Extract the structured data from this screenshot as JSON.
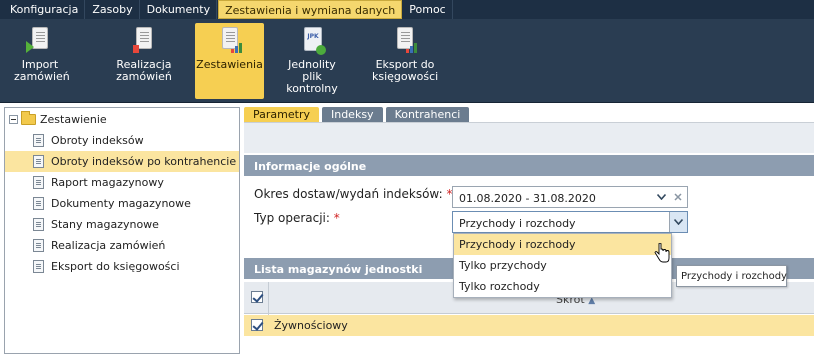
{
  "menu": {
    "items": [
      "Konfiguracja",
      "Zasoby",
      "Dokumenty",
      "Zestawienia i wymiana danych",
      "Pomoc"
    ],
    "active_index": 3
  },
  "toolbar": {
    "buttons": [
      {
        "line1": "Import",
        "line2": "zamówień",
        "icon": "import-orders-icon"
      },
      {
        "line1": "Realizacja",
        "line2": "zamówień",
        "icon": "orders-fulfillment-icon"
      },
      {
        "line1": "Zestawienia",
        "line2": "",
        "icon": "reports-icon"
      },
      {
        "line1": "Jednolity plik",
        "line2": "kontrolny",
        "icon": "jpk-file-icon"
      },
      {
        "line1": "Eksport do",
        "line2": "księgowości",
        "icon": "accounting-export-icon"
      }
    ],
    "jpk_badge": "JPK"
  },
  "tree": {
    "root": "Zestawienie",
    "items": [
      "Obroty indeksów",
      "Obroty indeksów po kontrahencie",
      "Raport magazynowy",
      "Dokumenty magazynowe",
      "Stany magazynowe",
      "Realizacja zamówień",
      "Eksport do księgowości"
    ],
    "selected_index": 1
  },
  "tabs": [
    "Parametry",
    "Indeksy",
    "Kontrahenci"
  ],
  "general": {
    "title": "Informacje ogólne",
    "period_label": "Okres dostaw/wydań indeksów:",
    "period_value": "01.08.2020 - 31.08.2020",
    "type_label": "Typ operacji:",
    "type_value": "Przychody i rozchody",
    "required_mark": "*"
  },
  "dropdown": {
    "options": [
      "Przychody i rozchody",
      "Tylko przychody",
      "Tylko rozchody"
    ],
    "highlighted_index": 0,
    "tooltip": "Przychody i rozchody"
  },
  "warehouses": {
    "title": "Lista magazynów jednostki",
    "column_header": "Skrót",
    "rows": [
      {
        "name": "Żywnościowy",
        "checked": true
      }
    ]
  },
  "colors": {
    "menu_bg": "#1d2f44",
    "toolbar_bg": "#2a3d52",
    "accent": "#f6cf52",
    "highlight": "#fbe5a0",
    "section_header": "#8d9db0",
    "required": "#d02020"
  }
}
